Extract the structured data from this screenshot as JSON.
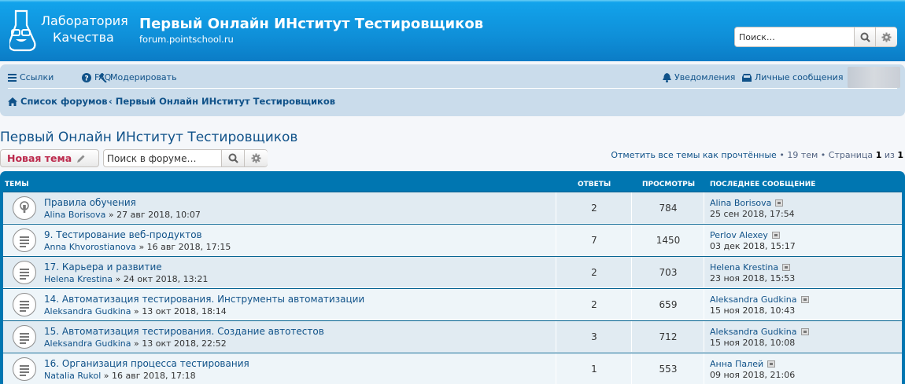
{
  "header": {
    "logo_line1": "Лаборатория",
    "logo_line2": "Качества",
    "site_title": "Первый Онлайн ИНститут Тестировщиков",
    "site_description": "forum.pointschool.ru",
    "search_placeholder": "Поиск…"
  },
  "navbar": {
    "links_label": "Ссылки",
    "faq_label": "FAQ",
    "moderate_label": "Модерировать",
    "notifications_label": "Уведомления",
    "messages_label": "Личные сообщения",
    "breadcrumb": [
      "Список форумов",
      "Первый Онлайн ИНститут Тестировщиков"
    ]
  },
  "forum": {
    "title": "Первый Онлайн ИНститут Тестировщиков",
    "new_topic_label": "Новая тема",
    "search_placeholder": "Поиск в форуме…",
    "mark_read": "Отметить все темы как прочтённые",
    "topics_count": "19 тем",
    "page_label": "Страница",
    "page_current": "1",
    "page_of": "из",
    "page_total": "1"
  },
  "table": {
    "headers": {
      "topics": "Темы",
      "replies": "Ответы",
      "views": "Просмотры",
      "last_post": "Последнее сообщение"
    },
    "rows": [
      {
        "title": "Правила обучения",
        "author": "Alina Borisova",
        "date": "» 27 авг 2018, 10:07",
        "replies": "2",
        "views": "784",
        "last_author": "Alina Borisova",
        "last_date": "25 сен 2018, 17:54",
        "icon": "announcement-icon"
      },
      {
        "title": "9. Тестирование веб-продуктов",
        "author": "Anna Khvorostianova",
        "date": "» 16 авг 2018, 17:15",
        "replies": "7",
        "views": "1450",
        "last_author": "Perlov Alexey",
        "last_date": "03 дек 2018, 15:17",
        "icon": "topic-icon"
      },
      {
        "title": "17. Карьера и развитие",
        "author": "Helena Krestina",
        "date": "» 24 окт 2018, 13:21",
        "replies": "2",
        "views": "703",
        "last_author": "Helena Krestina",
        "last_date": "23 ноя 2018, 15:53",
        "icon": "topic-icon"
      },
      {
        "title": "14. Автоматизация тестирования. Инструменты автоматизации",
        "author": "Aleksandra Gudkina",
        "date": "» 13 окт 2018, 18:14",
        "replies": "2",
        "views": "659",
        "last_author": "Aleksandra Gudkina",
        "last_date": "15 ноя 2018, 10:43",
        "icon": "topic-icon"
      },
      {
        "title": "15. Автоматизация тестирования. Создание автотестов",
        "author": "Aleksandra Gudkina",
        "date": "» 13 окт 2018, 22:52",
        "replies": "3",
        "views": "712",
        "last_author": "Aleksandra Gudkina",
        "last_date": "15 ноя 2018, 10:08",
        "icon": "topic-icon"
      },
      {
        "title": "16. Организация процесса тестирования",
        "author": "Natalia Rukol",
        "date": "» 16 авг 2018, 17:18",
        "replies": "1",
        "views": "553",
        "last_author": "Анна Палей",
        "last_date": "09 ноя 2018, 21:06",
        "icon": "topic-icon"
      }
    ]
  },
  "colors": {
    "header_blue": "#0f8fd8",
    "navbar_bg": "#cadceb",
    "link": "#105289",
    "new_topic_red": "#bc2a4d",
    "table_head": "#0076b1"
  }
}
